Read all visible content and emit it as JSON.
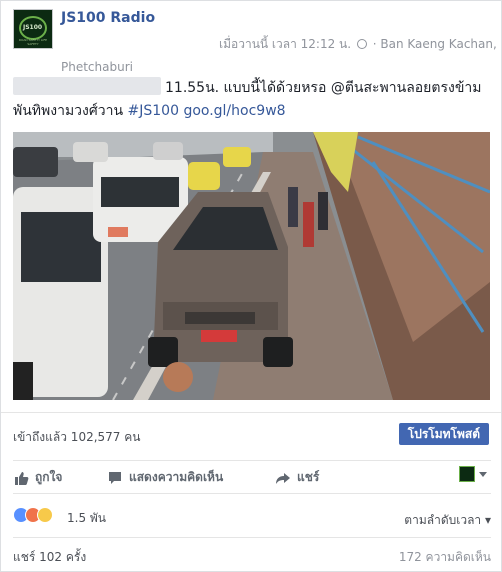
{
  "post": {
    "page_name": "JS100 Radio",
    "avatar_text": "JS100",
    "avatar_sub": "ROAD SAFETY LIFE SAFETY",
    "timestamp": "เมื่อวานนี้ เวลา 12:12 น.",
    "location": "· Ban Kaeng Kachan, Phetchaburi",
    "text_part1": "11.55น. แบบนี้ได้ด้วยหรอ @ตีนสะพานลอยตรงข้ามพันทิพงามวงศ์วาน ",
    "hashtag": "#JS100",
    "link": "goo.gl/hoc9w8",
    "photo_alt": "Van parked on a sidewalk next to a pedestrian bridge with traffic on the road"
  },
  "reach": {
    "text": "เข้าถึงแล้ว 102,577 คน",
    "promote_label": "โปรโมทโพสต์"
  },
  "actions": {
    "like_label": "ถูกใจ",
    "comment_label": "แสดงความคิดเห็น",
    "share_label": "แชร์"
  },
  "reactions": {
    "count": "1.5 พัน",
    "sort_label": "ตามลำดับเวลา ▾"
  },
  "stats": {
    "shares": "แชร์ 102 ครั้ง",
    "comments": "172 ความคิดเห็น"
  },
  "colors": {
    "link": "#365899",
    "button": "#4267b2",
    "like": "#5890ff"
  }
}
